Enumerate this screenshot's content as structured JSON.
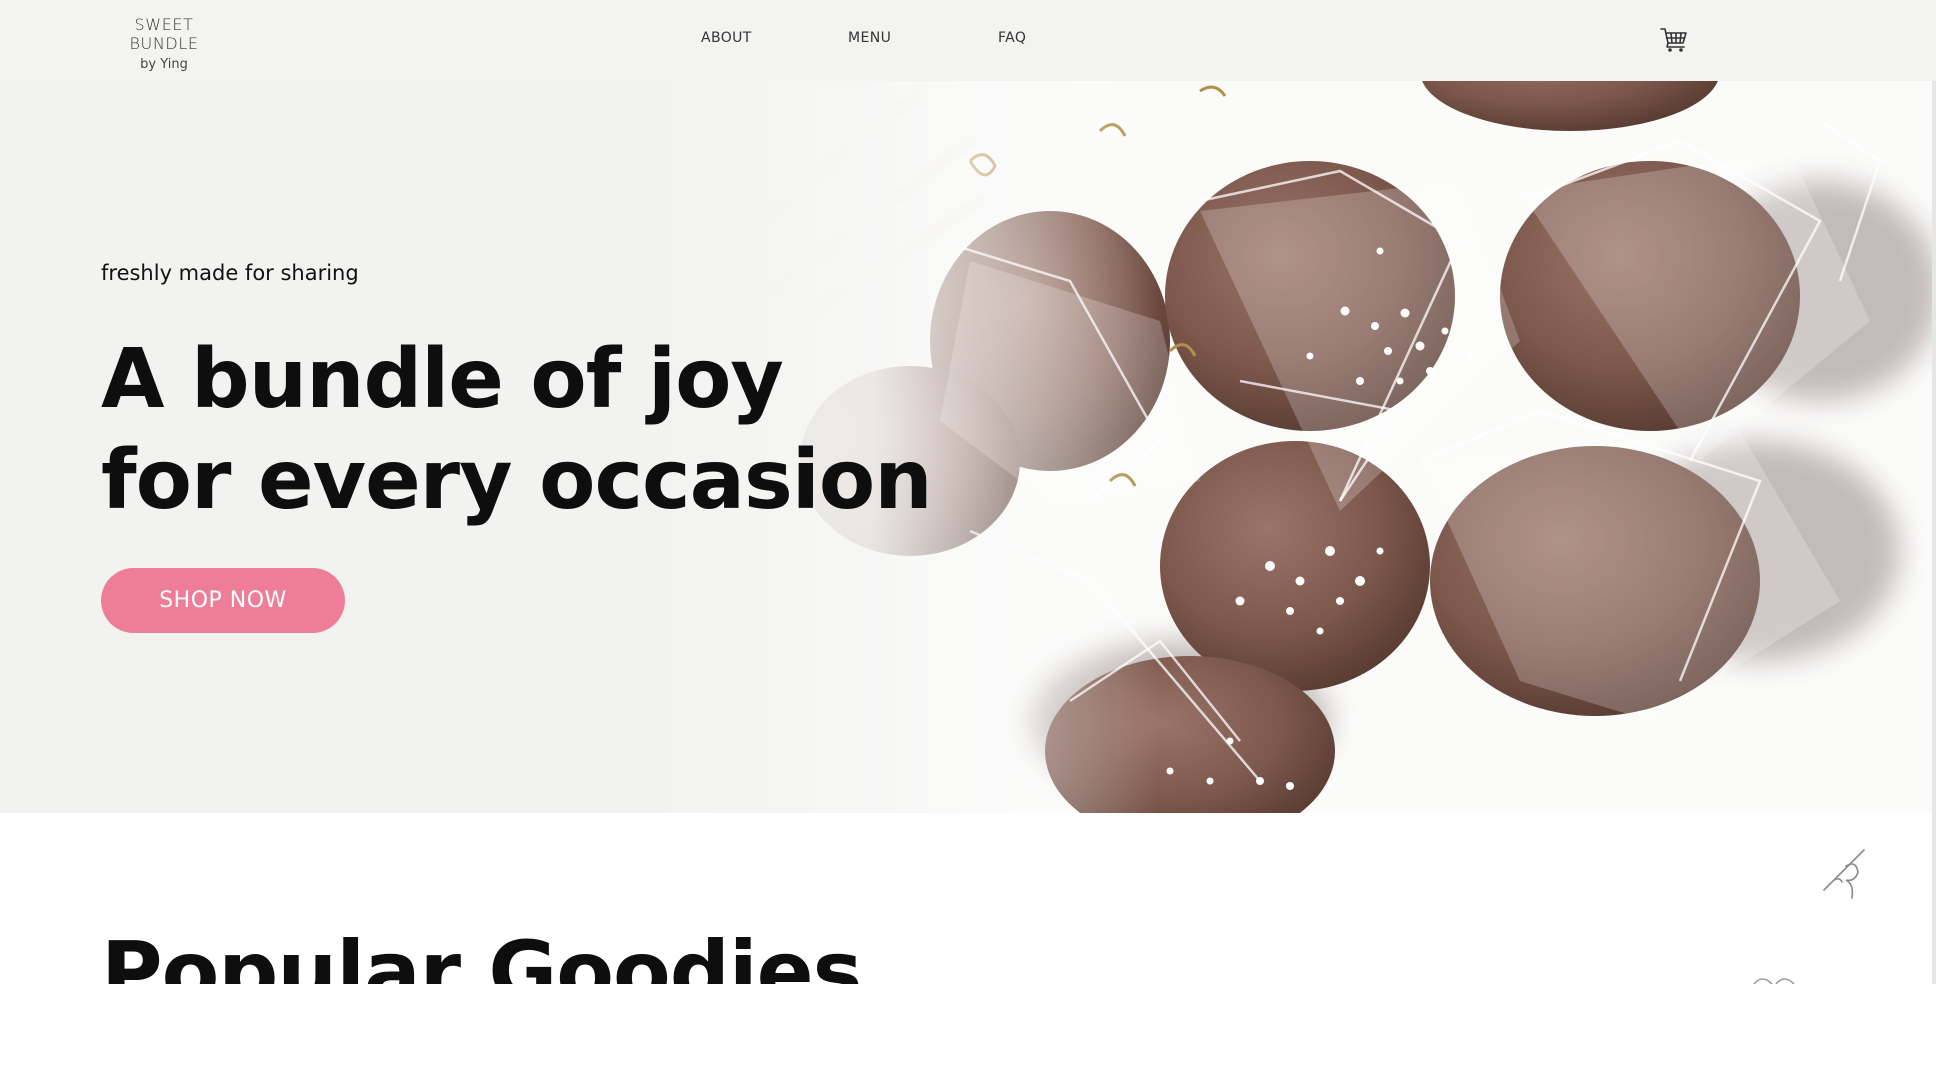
{
  "header": {
    "logo_line1": "SWEET BUNDLE",
    "logo_line2": "by Ying",
    "nav": [
      "ABOUT",
      "MENU",
      "FAQ"
    ],
    "cart_icon": "shopping-cart-icon"
  },
  "hero": {
    "tagline": "freshly made for sharing",
    "headline_line1": "A bundle of joy",
    "headline_line2": "for every occasion",
    "cta_label": "SHOP NOW"
  },
  "popular": {
    "title": "Popular Goodies"
  },
  "colors": {
    "accent": "#ee7d98",
    "header_bg": "#f3f3f1",
    "hero_bg": "#f2f2f0",
    "chocolate": "#7a5446"
  }
}
